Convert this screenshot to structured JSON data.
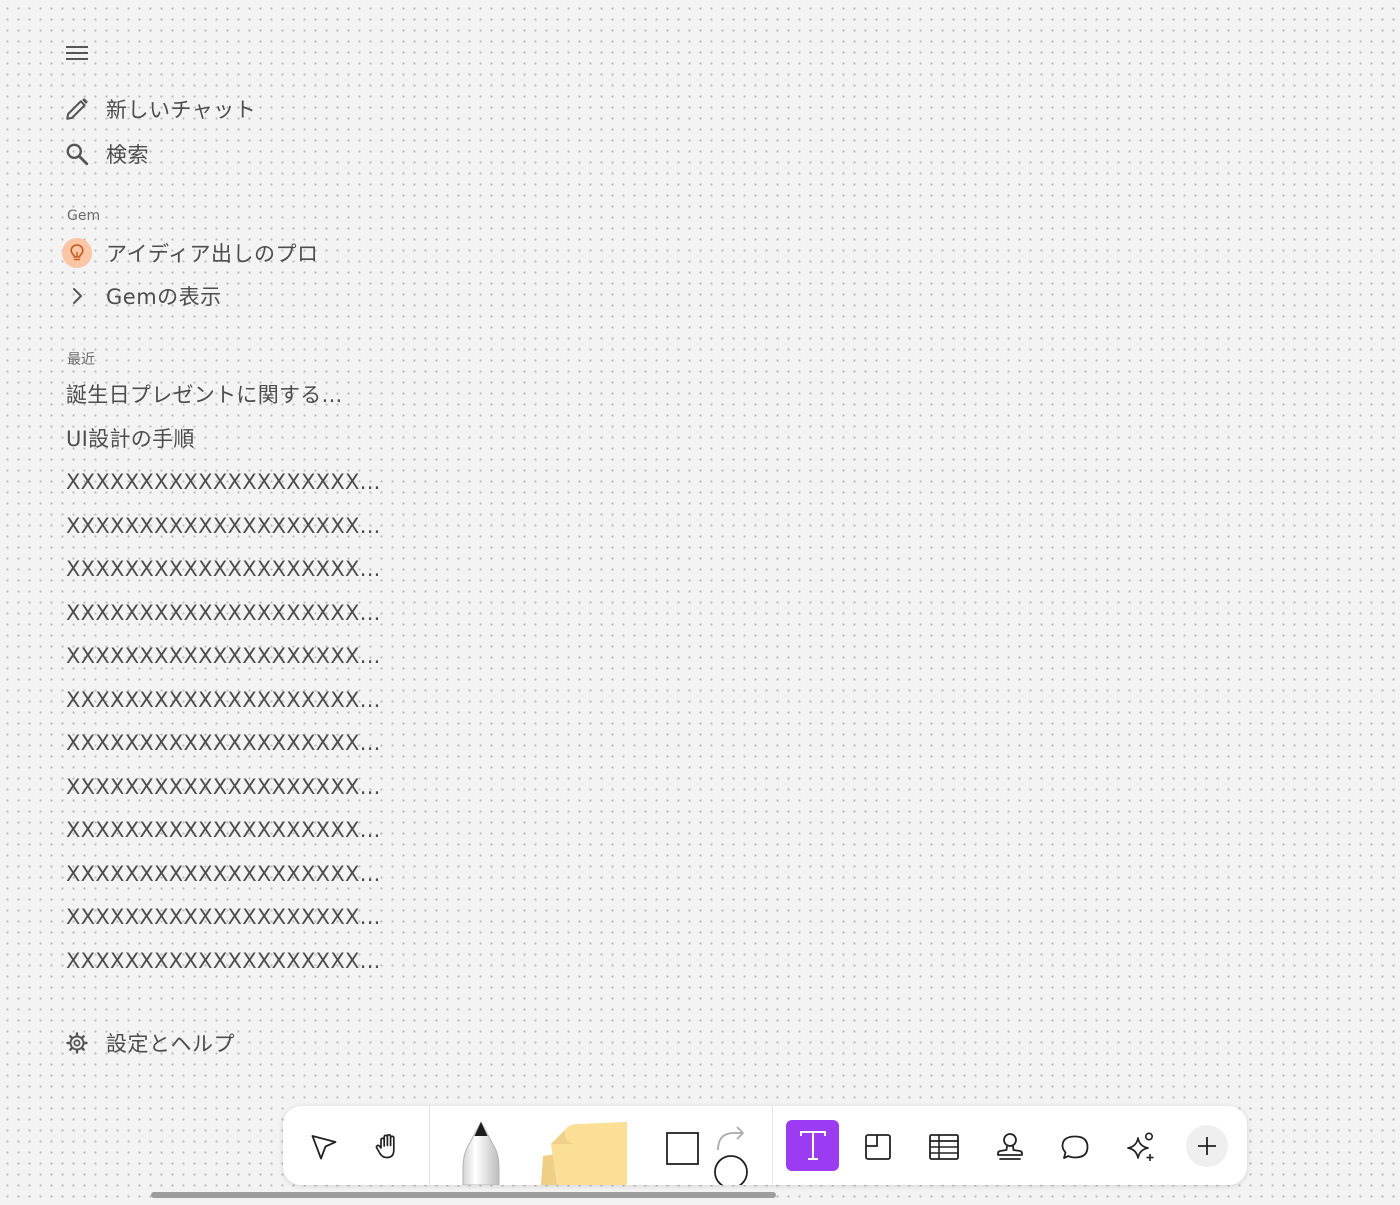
{
  "sidebar": {
    "menu_icon": "hamburger-menu-icon",
    "new_chat": {
      "label": "新しいチャット",
      "icon": "pencil-icon"
    },
    "search": {
      "label": "検索",
      "icon": "search-icon"
    },
    "gem_section": {
      "title": "Gem",
      "items": [
        {
          "label": "アイディア出しのプロ",
          "icon": "lightbulb-icon"
        },
        {
          "label": "Gemの表示",
          "icon": "chevron-right-icon"
        }
      ]
    },
    "recent_section": {
      "title": "最近",
      "items": [
        {
          "label": "誕生日プレゼントに関する..."
        },
        {
          "label": "UI設計の手順"
        },
        {
          "label": "XXXXXXXXXXXXXXXXXXXX..."
        },
        {
          "label": "XXXXXXXXXXXXXXXXXXXX..."
        },
        {
          "label": "XXXXXXXXXXXXXXXXXXXX..."
        },
        {
          "label": "XXXXXXXXXXXXXXXXXXXX..."
        },
        {
          "label": "XXXXXXXXXXXXXXXXXXXX..."
        },
        {
          "label": "XXXXXXXXXXXXXXXXXXXX..."
        },
        {
          "label": "XXXXXXXXXXXXXXXXXXXX..."
        },
        {
          "label": "XXXXXXXXXXXXXXXXXXXX..."
        },
        {
          "label": "XXXXXXXXXXXXXXXXXXXX..."
        },
        {
          "label": "XXXXXXXXXXXXXXXXXXXX..."
        },
        {
          "label": "XXXXXXXXXXXXXXXXXXXX..."
        },
        {
          "label": "XXXXXXXXXXXXXXXXXXXX..."
        }
      ]
    },
    "settings": {
      "label": "設定とヘルプ",
      "icon": "gear-icon"
    }
  },
  "toolbar": {
    "tools": [
      {
        "name": "select-tool",
        "icon": "pointer-arrow-icon"
      },
      {
        "name": "hand-tool",
        "icon": "hand-icon"
      },
      {
        "name": "pen-tool",
        "icon": "pen-icon"
      },
      {
        "name": "sticky-note-tool",
        "icon": "sticky-note-icon"
      },
      {
        "name": "shapes-tool",
        "icon": "square-circle-arrow-icon"
      },
      {
        "name": "text-tool",
        "icon": "text-t-icon",
        "selected": true
      },
      {
        "name": "frame-tool",
        "icon": "frame-icon"
      },
      {
        "name": "table-tool",
        "icon": "table-icon"
      },
      {
        "name": "stamp-tool",
        "icon": "stamp-icon"
      },
      {
        "name": "comment-tool",
        "icon": "speech-bubble-icon"
      },
      {
        "name": "ai-tool",
        "icon": "sparkle-icon"
      },
      {
        "name": "more-tools",
        "icon": "plus-icon"
      }
    ]
  },
  "colors": {
    "background": "#f3f3f3",
    "grid_dots": "#b9b9b9",
    "text": "#4d4d4d",
    "accent_purple": "#9b3cf2",
    "gem_bulb_bg": "#fbc6a6",
    "gem_bulb_stroke": "#c45a1c",
    "sticky_note": "#fbdf96"
  }
}
